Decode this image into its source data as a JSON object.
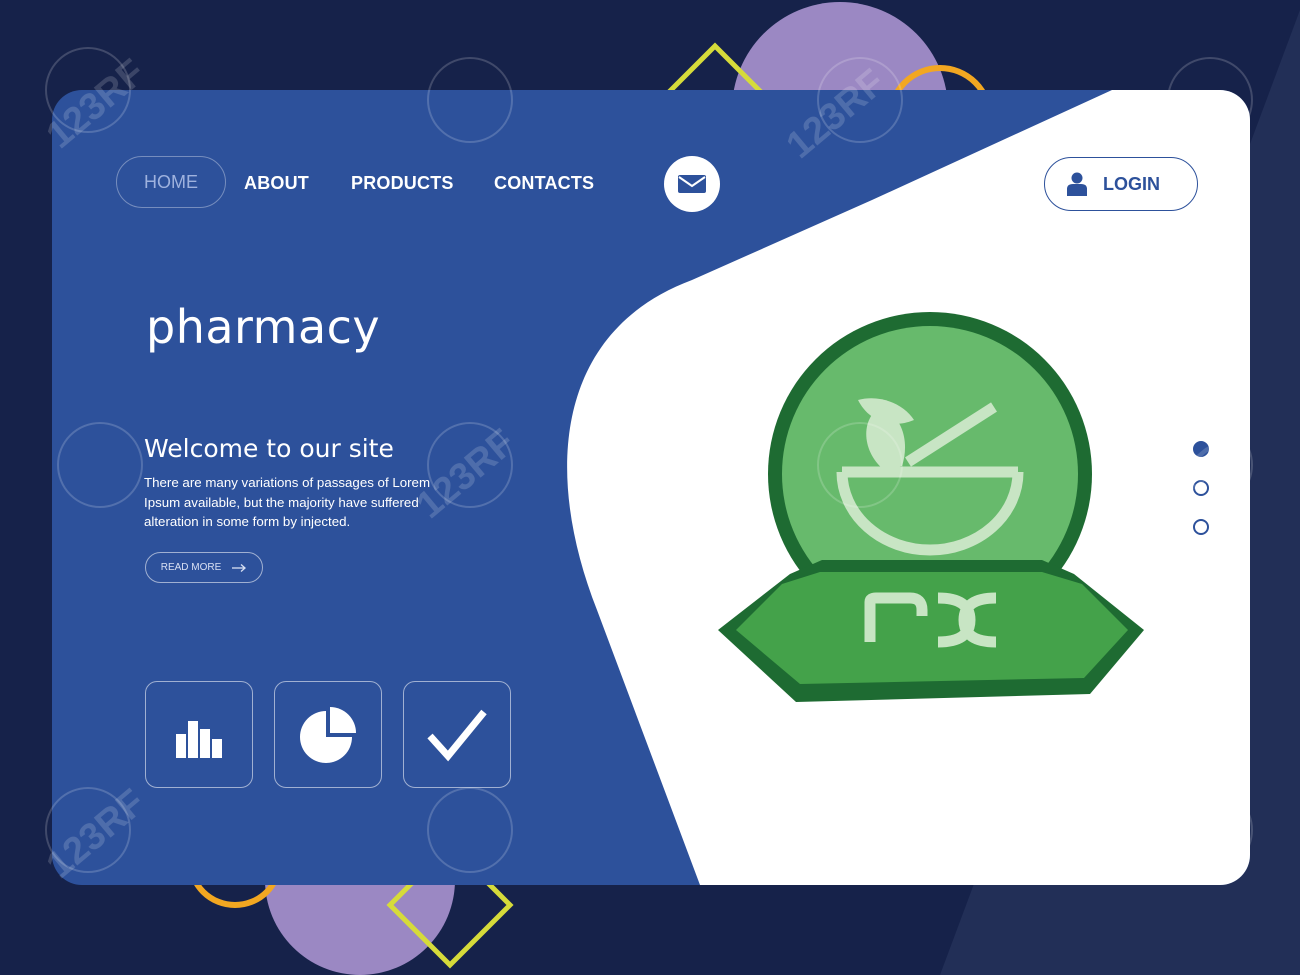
{
  "nav": {
    "home": "HOME",
    "about": "ABOUT",
    "products": "PRODUCTS",
    "contacts": "CONTACTS",
    "mail_icon": "envelope-icon"
  },
  "login": {
    "label": "LOGIN",
    "icon": "user-icon"
  },
  "hero": {
    "title": "pharmacy",
    "subtitle": "Welcome to our site",
    "body": "There are many variations of passages of Lorem Ipsum available, but the majority have suffered alteration in some form by injected.",
    "read_more": "READ MORE",
    "read_more_icon": "arrow-right-icon"
  },
  "features": [
    {
      "icon": "bar-chart-icon"
    },
    {
      "icon": "pie-chart-icon"
    },
    {
      "icon": "checkmark-icon"
    }
  ],
  "illustration": {
    "icon": "rx-mortar-pestle-icon",
    "text": "rx"
  },
  "slider": {
    "count": 3,
    "active_index": 0
  },
  "watermark": {
    "text": "123RF"
  },
  "colors": {
    "background": "#16224a",
    "panel_blue": "#2d519b",
    "white": "#ffffff",
    "green_dark": "#1e6b32",
    "green_mid": "#44a24a",
    "green_light": "#67ba6c",
    "purple": "#9b88c3",
    "yellow": "#d6db3a",
    "orange": "#f2a721"
  }
}
